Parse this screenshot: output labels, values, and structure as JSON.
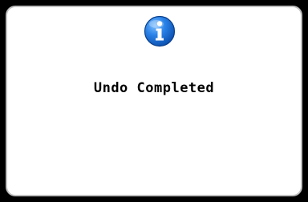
{
  "dialog": {
    "icon": "info-icon",
    "message": "Undo Completed"
  },
  "colors": {
    "screen_background": "#000000",
    "dialog_background": "#ffffff",
    "dialog_border": "#bfbfbf",
    "icon_blue": "#1e6fd6",
    "text": "#000000"
  }
}
